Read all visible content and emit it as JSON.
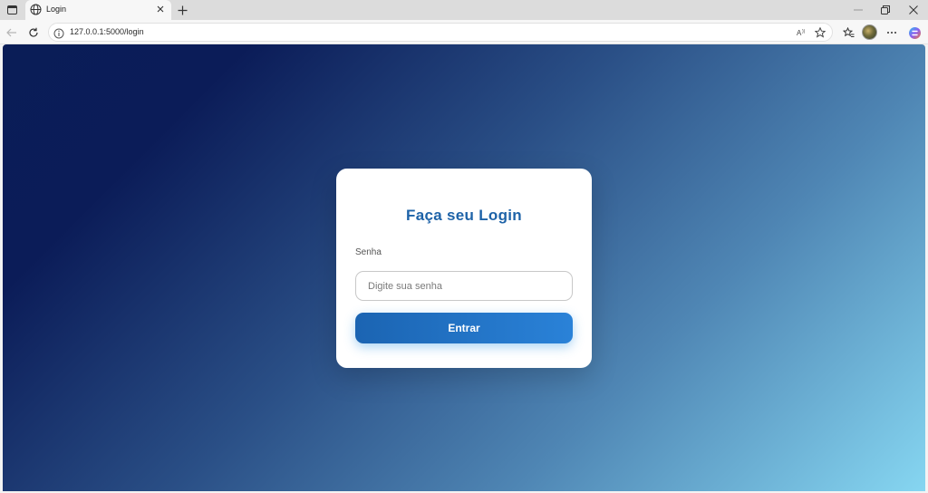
{
  "browser": {
    "tab": {
      "title": "Login"
    },
    "address": {
      "url": "127.0.0.1:5000/login"
    },
    "icons": [
      "tab-actions-icon",
      "globe-icon",
      "close-icon",
      "plus-icon",
      "minimize-icon",
      "restore-icon",
      "window-close-icon",
      "back-icon",
      "refresh-icon",
      "info-icon",
      "read-aloud-icon",
      "star-icon",
      "favorites-icon",
      "more-icon",
      "copilot-icon"
    ]
  },
  "login": {
    "title": "Faça seu Login",
    "password_label": "Senha",
    "password_placeholder": "Digite sua senha",
    "submit_label": "Entrar"
  },
  "colors": {
    "title": "#1e63a8",
    "button_start": "#1b64b2",
    "button_end": "#2a82d8",
    "bg_dark": "#0b1c58",
    "bg_light": "#86d6f1"
  }
}
